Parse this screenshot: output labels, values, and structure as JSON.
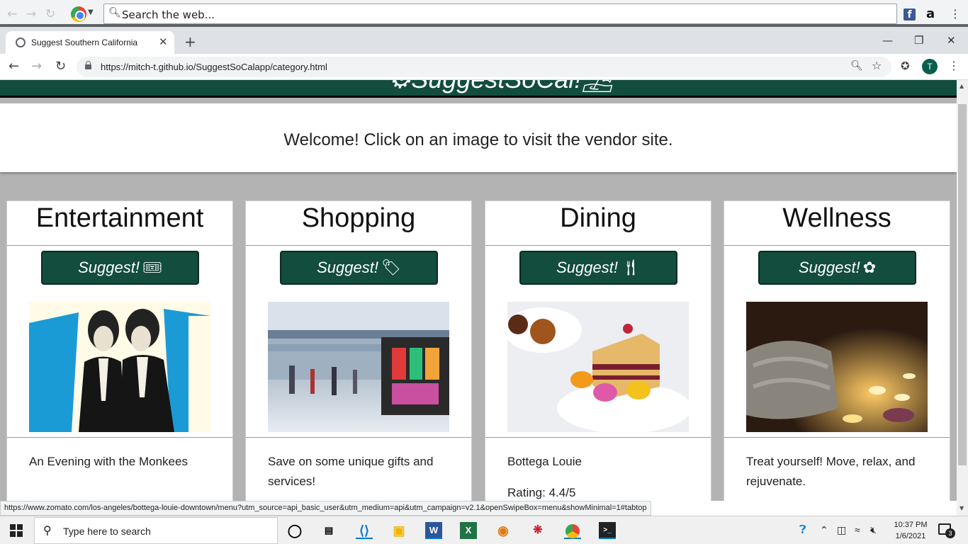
{
  "outer_bar": {
    "search_placeholder": "Search the web..."
  },
  "tab": {
    "title": "Suggest Southern California"
  },
  "address": {
    "url": "https://mitch-t.github.io/SuggestSoCalapp/category.html"
  },
  "profile": {
    "initial": "T"
  },
  "site": {
    "brand": "SuggestSoCal!",
    "welcome": "Welcome! Click on an image to visit the vendor site."
  },
  "cards": [
    {
      "category": "Entertainment",
      "button": "Suggest!",
      "icon": "ticket-icon",
      "description": "An Evening with the Monkees"
    },
    {
      "category": "Shopping",
      "button": "Suggest!",
      "icon": "tag-icon",
      "description": "Save on some unique gifts and services!"
    },
    {
      "category": "Dining",
      "button": "Suggest!",
      "icon": "utensils-icon",
      "description": "Bottega Louie",
      "rating": "Rating: 4.4/5"
    },
    {
      "category": "Wellness",
      "button": "Suggest!",
      "icon": "spa-icon",
      "description": "Treat yourself! Move, relax, and rejuvenate."
    }
  ],
  "status_url": "https://www.zomato.com/los-angeles/bottega-louie-downtown/menu?utm_source=api_basic_user&utm_medium=api&utm_campaign=v2.1&openSwipeBox=menu&showMinimal=1#tabtop",
  "taskbar": {
    "search_placeholder": "Type here to search",
    "time": "10:37 PM",
    "date": "1/6/2021",
    "notifications": "3"
  }
}
